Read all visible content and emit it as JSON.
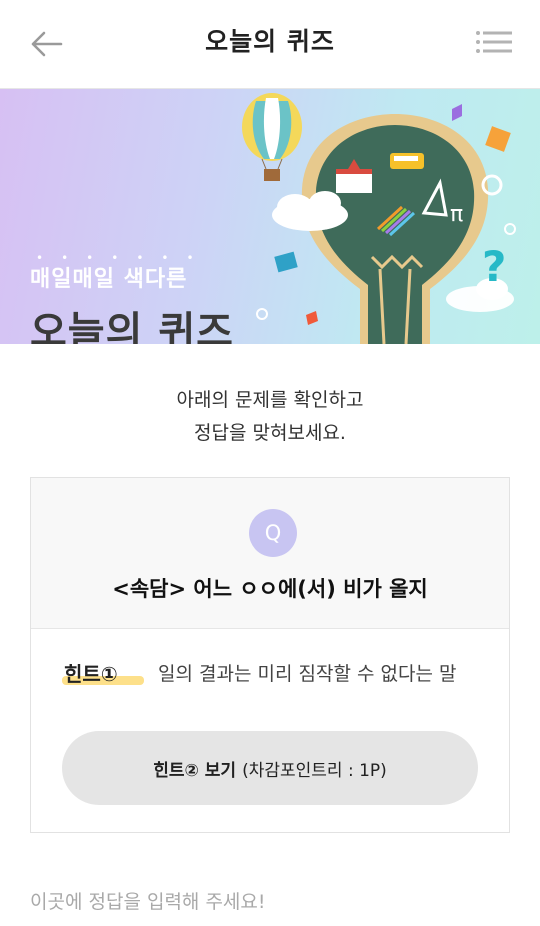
{
  "header": {
    "title": "오늘의 퀴즈",
    "back_icon": "arrow-left-icon",
    "menu_icon": "hamburger-menu-icon"
  },
  "banner": {
    "subtitle": "매일매일 색다른",
    "title": "오늘의 퀴즈"
  },
  "intro": {
    "line1": "아래의 문제를 확인하고",
    "line2": "정답을 맞혀보세요."
  },
  "quiz": {
    "badge": "Q",
    "question": "<속담> 어느 ㅇㅇ에(서) 비가 올지",
    "hint1_label": "힌트①",
    "hint1_text": "일의 결과는 미리 짐작할 수 없다는 말",
    "hint2_strong": "힌트② 보기",
    "hint2_note": "(차감포인트리 : 1P)"
  },
  "answer": {
    "placeholder": "이곳에 정답을 입력해 주세요!"
  },
  "colors": {
    "q_badge": "#c8c5f2",
    "hint_highlight": "#fde08a",
    "hint_button": "#e5e5e5"
  }
}
